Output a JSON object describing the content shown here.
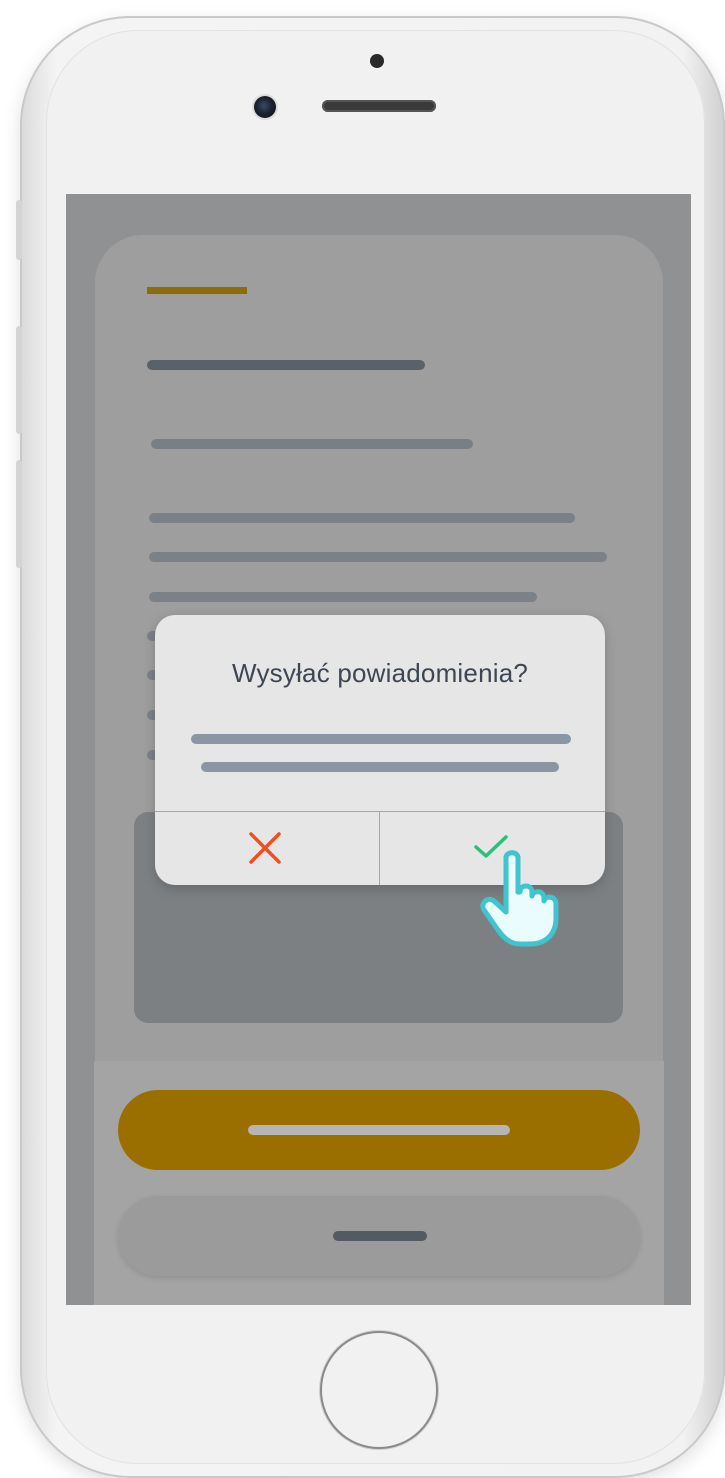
{
  "device": {
    "frame_color": "#f1f1f1",
    "screen_overlay_color": "#909192"
  },
  "app": {
    "accent_color": "#9a6f00"
  },
  "dialog": {
    "title": "Wysyłać powiadomienia?",
    "cancel_icon": "close-icon",
    "cancel_color": "#f24e1e",
    "confirm_icon": "check-icon",
    "confirm_color": "#22c47a"
  },
  "cursor": {
    "icon": "hand-pointer-icon",
    "color": "#40c4cf"
  }
}
